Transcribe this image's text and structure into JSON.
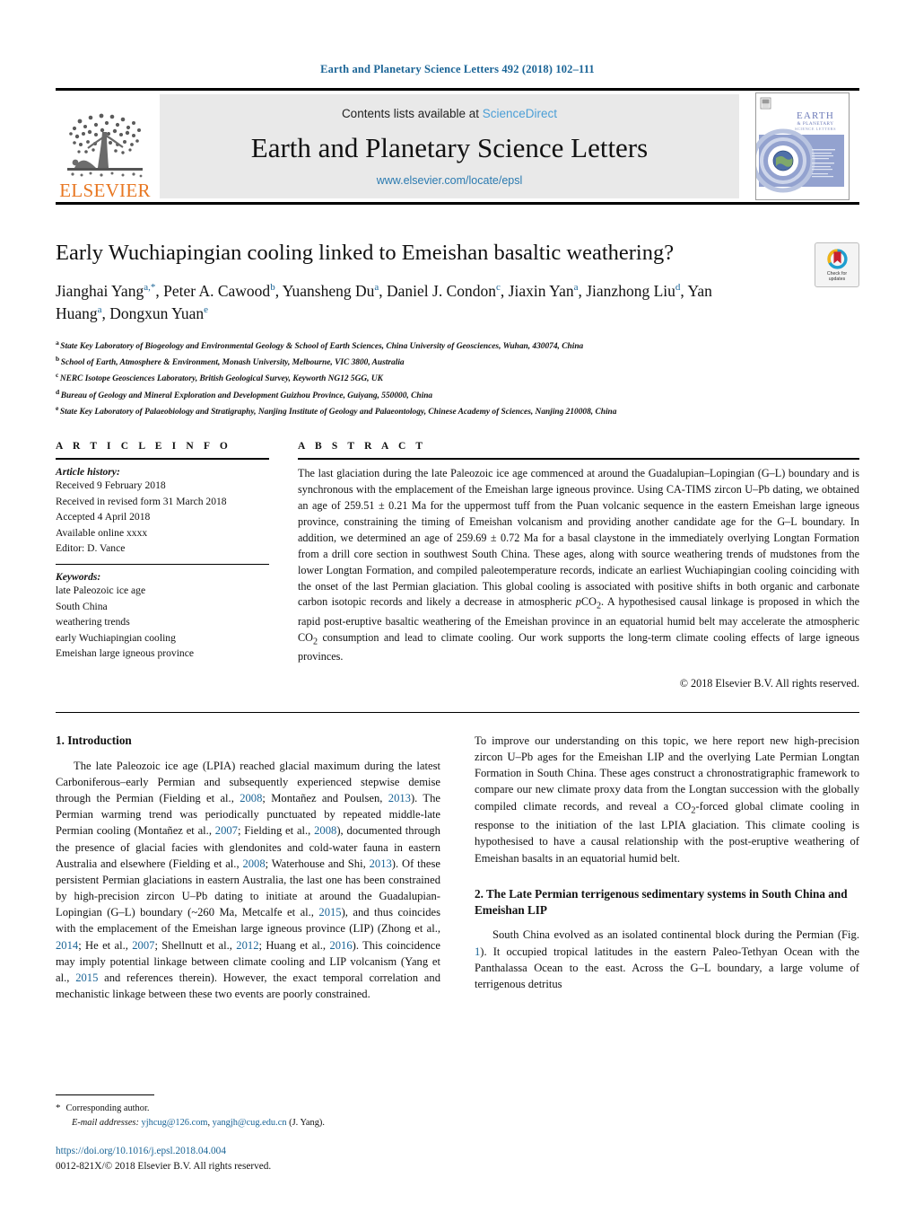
{
  "running_head": "Earth and Planetary Science Letters 492 (2018) 102–111",
  "masthead": {
    "contents_prefix": "Contents lists available at ",
    "sciencedirect": "ScienceDirect",
    "journal_title": "Earth and Planetary Science Letters",
    "journal_url": "www.elsevier.com/locate/epsl",
    "publisher_wordmark": "ELSEVIER",
    "cover_title_line1": "EARTH",
    "cover_title_line2": "& PLANETARY",
    "cover_title_line3": "SCIENCE LETTERS"
  },
  "colors": {
    "link": "#1a6496",
    "sciencedirect": "#4a9ed6",
    "elsevier_orange": "#E87722",
    "cover_blue": "#8a9bcd"
  },
  "article": {
    "title": "Early Wuchiapingian cooling linked to Emeishan basaltic weathering?",
    "authors": [
      {
        "name": "Jianghai Yang",
        "marks": "a,*",
        "sep": ", "
      },
      {
        "name": "Peter A. Cawood",
        "marks": "b",
        "sep": ", "
      },
      {
        "name": "Yuansheng Du",
        "marks": "a",
        "sep": ", "
      },
      {
        "name": "Daniel J. Condon",
        "marks": "c",
        "sep": ", "
      },
      {
        "name": "Jiaxin Yan",
        "marks": "a",
        "sep": ", "
      },
      {
        "name": "Jianzhong Liu",
        "marks": "d",
        "sep": ", "
      },
      {
        "name": "Yan Huang",
        "marks": "a",
        "sep": ", "
      },
      {
        "name": "Dongxun Yuan",
        "marks": "e",
        "sep": ""
      }
    ],
    "affiliations": [
      {
        "mark": "a",
        "text": "State Key Laboratory of Biogeology and Environmental Geology & School of Earth Sciences, China University of Geosciences, Wuhan, 430074, China"
      },
      {
        "mark": "b",
        "text": "School of Earth, Atmosphere & Environment, Monash University, Melbourne, VIC 3800, Australia"
      },
      {
        "mark": "c",
        "text": "NERC Isotope Geosciences Laboratory, British Geological Survey, Keyworth NG12 5GG, UK"
      },
      {
        "mark": "d",
        "text": "Bureau of Geology and Mineral Exploration and Development Guizhou Province, Guiyang, 550000, China"
      },
      {
        "mark": "e",
        "text": "State Key Laboratory of Palaeobiology and Stratigraphy, Nanjing Institute of Geology and Palaeontology, Chinese Academy of Sciences, Nanjing 210008, China"
      }
    ],
    "crossmark_label_line1": "Check for",
    "crossmark_label_line2": "updates"
  },
  "article_info": {
    "heading": "A R T I C L E    I N F O",
    "history_heading": "Article history:",
    "history": [
      "Received 9 February 2018",
      "Received in revised form 31 March 2018",
      "Accepted 4 April 2018",
      "Available online xxxx",
      "Editor: D. Vance"
    ],
    "keywords_heading": "Keywords:",
    "keywords": [
      "late Paleozoic ice age",
      "South China",
      "weathering trends",
      "early Wuchiapingian cooling",
      "Emeishan large igneous province"
    ]
  },
  "abstract": {
    "heading": "A B S T R A C T",
    "text": "The last glaciation during the late Paleozoic ice age commenced at around the Guadalupian–Lopingian (G–L) boundary and is synchronous with the emplacement of the Emeishan large igneous province. Using CA-TIMS zircon U–Pb dating, we obtained an age of 259.51 ± 0.21 Ma for the uppermost tuff from the Puan volcanic sequence in the eastern Emeishan large igneous province, constraining the timing of Emeishan volcanism and providing another candidate age for the G–L boundary. In addition, we determined an age of 259.69 ± 0.72 Ma for a basal claystone in the immediately overlying Longtan Formation from a drill core section in southwest South China. These ages, along with source weathering trends of mudstones from the lower Longtan Formation, and compiled paleotemperature records, indicate an earliest Wuchiapingian cooling coinciding with the onset of the last Permian glaciation. This global cooling is associated with positive shifts in both organic and carbonate carbon isotopic records and likely a decrease in atmospheric pCO2. A hypothesised causal linkage is proposed in which the rapid post-eruptive basaltic weathering of the Emeishan province in an equatorial humid belt may accelerate the atmospheric CO2 consumption and lead to climate cooling. Our work supports the long-term climate cooling effects of large igneous provinces.",
    "copyright": "© 2018 Elsevier B.V. All rights reserved."
  },
  "body": {
    "section1_heading": "1. Introduction",
    "section1_para1": "The late Paleozoic ice age (LPIA) reached glacial maximum during the latest Carboniferous–early Permian and subsequently experienced stepwise demise through the Permian (Fielding et al., 2008; Montañez and Poulsen, 2013). The Permian warming trend was periodically punctuated by repeated middle-late Permian cooling (Montañez et al., 2007; Fielding et al., 2008), documented through the presence of glacial facies with glendonites and cold-water fauna in eastern Australia and elsewhere (Fielding et al., 2008; Waterhouse and Shi, 2013). Of these persistent Permian glaciations in eastern Australia, the last one has been constrained by high-precision zircon U–Pb dating to initiate at around the Guadalupian-Lopingian (G–L) boundary (~260 Ma, Metcalfe et al., 2015), and thus coincides with the emplacement of the Emeishan large igneous province (LIP) (Zhong et al., 2014; He et al., 2007; Shellnutt et al., 2012; Huang et al., 2016). This coincidence may imply potential linkage between climate cooling and LIP volcanism (Yang et al., 2015 and references therein). However, the exact temporal correlation and mechanistic linkage between these two events are poorly constrained.",
    "section1_para2": "To improve our understanding on this topic, we here report new high-precision zircon U–Pb ages for the Emeishan LIP and the overlying Late Permian Longtan Formation in South China. These ages construct a chronostratigraphic framework to compare our new climate proxy data from the Longtan succession with the globally compiled climate records, and reveal a CO2-forced global climate cooling in response to the initiation of the last LPIA glaciation. This climate cooling is hypothesised to have a causal relationship with the post-eruptive weathering of Emeishan basalts in an equatorial humid belt.",
    "section2_heading": "2. The Late Permian terrigenous sedimentary systems in South China and Emeishan LIP",
    "section2_para1": "South China evolved as an isolated continental block during the Permian (Fig. 1). It occupied tropical latitudes in the eastern Paleo-Tethyan Ocean with the Panthalassa Ocean to the east. Across the G–L boundary, a large volume of terrigenous detritus"
  },
  "footnote": {
    "corresponding": "Corresponding author.",
    "email_label": "E-mail addresses:",
    "email1": "yjhcug@126.com",
    "email2": "yangjh@cug.edu.cn",
    "email_attrib": "(J. Yang).",
    "doi": "https://doi.org/10.1016/j.epsl.2018.04.004",
    "issn_line": "0012-821X/© 2018 Elsevier B.V. All rights reserved."
  }
}
